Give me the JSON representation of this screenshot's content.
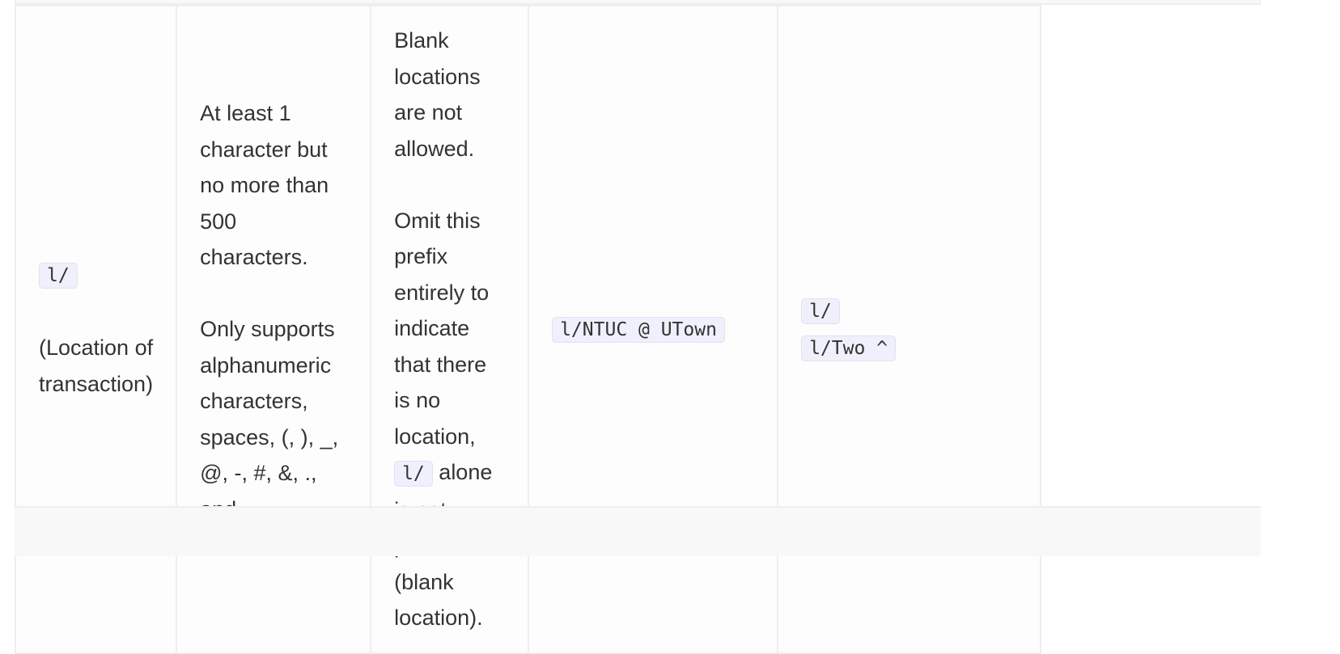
{
  "row": {
    "prefix": {
      "code": "l/",
      "description": "(Location of transaction)"
    },
    "constraints": [
      "At least 1 character but no more than 500 characters.",
      "Only supports alphanumeric characters, spaces, (, ), _, @, -, #, &, ., and , characters."
    ],
    "notes": {
      "line1": "Blank locations are not allowed.",
      "line2_before": "Omit this prefix entirely to indicate that there is no location,",
      "line2_code": "l/",
      "line2_after": "alone is not permitted (blank location)."
    },
    "valid_example": "l/NTUC @ UTown",
    "invalid_examples": [
      "l/",
      "l/Two ^"
    ]
  }
}
